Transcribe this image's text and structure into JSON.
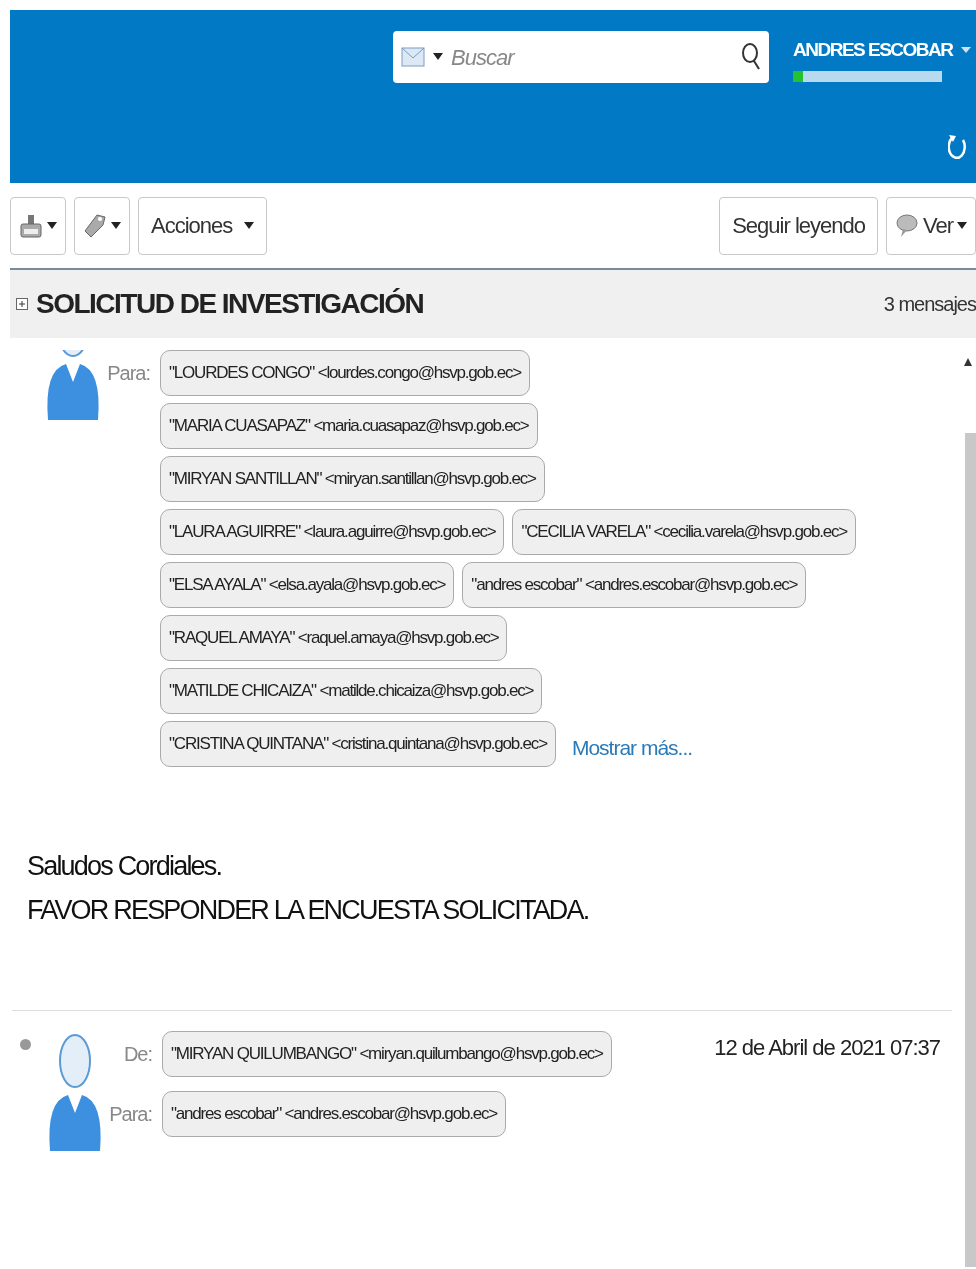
{
  "header": {
    "search": {
      "placeholder": "Buscar"
    },
    "user": {
      "name": "ANDRES ESCOBAR",
      "quota": {
        "level": 0.07
      }
    }
  },
  "toolbar": {
    "left": [
      {
        "kind": "icon"
      },
      {
        "kind": "icon"
      },
      {
        "kind": "text",
        "label": "Acciones"
      }
    ],
    "right": [
      {
        "kind": "text",
        "label": "Seguir leyendo"
      },
      {
        "kind": "icon-text",
        "label": "Ver"
      }
    ]
  },
  "thread": {
    "title": "SOLICITUD DE INVESTIGACIÓN",
    "count": "3 mensajes"
  },
  "messages": [
    {
      "unread": false,
      "to_label": "Para:",
      "to": [
        "\"LOURDES CONGO\" <lourdes.congo@hsvp.gob.ec>",
        "\"MARIA CUASAPAZ\" <maria.cuasapaz@hsvp.gob.ec>",
        "\"MIRYAN SANTILLAN\" <miryan.santillan@hsvp.gob.ec>",
        "\"LAURA AGUIRRE\" <laura.aguirre@hsvp.gob.ec>",
        "\"CECILIA VARELA\" <cecilia.varela@hsvp.gob.ec>",
        "\"ELSA AYALA\" <elsa.ayala@hsvp.gob.ec>",
        "\"andres escobar\" <andres.escobar@hsvp.gob.ec>",
        "\"RAQUEL AMAYA\" <raquel.amaya@hsvp.gob.ec>",
        "\"MATILDE CHICAIZA\" <matilde.chicaiza@hsvp.gob.ec>",
        "\"CRISTINA QUINTANA\" <cristina.quintana@hsvp.gob.ec>"
      ],
      "show_more": "Mostrar más...",
      "body": [
        "Saludos Cordiales.",
        "FAVOR RESPONDER LA ENCUESTA SOLICITADA."
      ]
    },
    {
      "unread": true,
      "from_label": "De:",
      "from": "\"MIRYAN QUILUMBANGO\" <miryan.quilumbango@hsvp.gob.ec>",
      "date": "12 de Abril de 2021 07:37",
      "to_label": "Para:",
      "to": [
        "\"andres escobar\" <andres.escobar@hsvp.gob.ec>"
      ]
    }
  ]
}
